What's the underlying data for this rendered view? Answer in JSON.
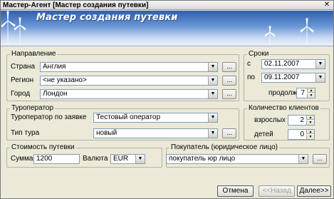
{
  "window": {
    "title": "Мастер-Агент [Мастер создания путевки]",
    "close": "✕"
  },
  "header": {
    "title": "Мастер создания путевки"
  },
  "direction": {
    "legend": "Направление",
    "country": {
      "label": "Страна",
      "value": "Англия"
    },
    "region": {
      "label": "Регион",
      "value": "<не указано>"
    },
    "city": {
      "label": "Город",
      "value": "Лондон"
    },
    "more": "..."
  },
  "dates": {
    "legend": "Сроки",
    "from_label": "с",
    "from_value": "02.11.2007",
    "to_label": "по",
    "to_value": "09.11.2007",
    "duration_label": "продолж.",
    "duration_value": "7"
  },
  "tour_operator": {
    "legend": "Туроператор",
    "operator": {
      "label": "Туроператор по заявке",
      "value": "Тестовый оператор"
    },
    "tour_type": {
      "label": "Тип тура",
      "value": "новый"
    },
    "more": "..."
  },
  "clients": {
    "legend": "Количество клиентов",
    "adults_label": "взрослых",
    "adults_value": "2",
    "children_label": "детей",
    "children_value": "0"
  },
  "cost": {
    "legend": "Стоимость путевки",
    "sum_label": "Сумма",
    "sum_value": "1200",
    "currency_label": "Валюта",
    "currency_value": "EUR"
  },
  "buyer": {
    "legend": "Покупатель (юридическое лицо)",
    "value": "покупатель юр лицо",
    "more": "..."
  },
  "footer": {
    "cancel": "Отмена",
    "back": "<<Назад",
    "next": "Далее>>"
  },
  "icons": {
    "dropdown": "▼",
    "spin_up": "▲",
    "spin_down": "▼"
  }
}
